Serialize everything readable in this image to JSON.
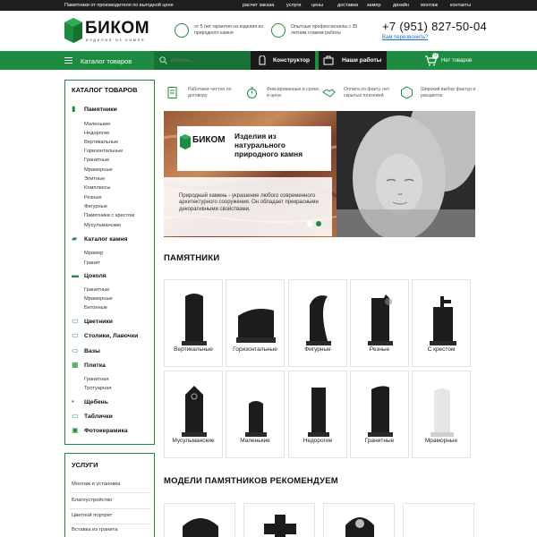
{
  "topbar": {
    "slogan": "Памятники от производителя по выгодной цене",
    "links": [
      "расчет заказа",
      "услуги",
      "цены",
      "доставка",
      "замер",
      "дизайн",
      "монтаж",
      "контакты"
    ]
  },
  "header": {
    "logo_text": "БИКОМ",
    "logo_sub": "изделия из камня",
    "feature1": "от 5 лет гарантия на изделия из природного камня",
    "feature2": "Опытные профессионалы с 35 летним стажем работы",
    "phone": "+7 (951) 827-50-04",
    "callback": "Вам перезвонить?"
  },
  "nav": {
    "catalog": "Каталог товаров",
    "search_placeholder": "Искать...",
    "constructor": "Конструктор",
    "our_works": "Наши работы",
    "cart_count": "0",
    "cart_text": "Нет товаров"
  },
  "sidebar": {
    "title": "КАТАЛОГ ТОВАРОВ",
    "categories": [
      {
        "label": "Памятники",
        "subs": [
          "Маленькие",
          "Недорогие",
          "Вертикальные",
          "Горизонтальные",
          "Гранитные",
          "Мраморные",
          "Элитные",
          "Комплексы",
          "Резные",
          "Фигурные",
          "Памятники с крестом",
          "Мусульманские"
        ]
      },
      {
        "label": "Каталог камня",
        "subs": [
          "Мрамор",
          "Гранит"
        ]
      },
      {
        "label": "Цоколя",
        "subs": [
          "Гранитные",
          "Мраморные",
          "Бетонные"
        ]
      },
      {
        "label": "Цветники",
        "subs": []
      },
      {
        "label": "Столики, Лавочки",
        "subs": []
      },
      {
        "label": "Вазы",
        "subs": []
      },
      {
        "label": "Плитка",
        "subs": [
          "Гранитная",
          "Тротуарная"
        ]
      },
      {
        "label": "Щебень",
        "subs": []
      },
      {
        "label": "Таблички",
        "subs": []
      },
      {
        "label": "Фотокерамика",
        "subs": []
      }
    ]
  },
  "services": {
    "title": "УСЛУГИ",
    "items": [
      "Монтаж и установка",
      "Благоустройство",
      "Цветной портрет",
      "Вставка из гранита"
    ]
  },
  "features": [
    {
      "icon": "document-icon",
      "text": "Работаем честно по договору"
    },
    {
      "icon": "stopwatch-icon",
      "text": "Фиксированные и сроки, и цена"
    },
    {
      "icon": "handshake-icon",
      "text": "Оплата по факту, нет скрытых платежей"
    },
    {
      "icon": "stone-icon",
      "text": "Широкий выбор фактур и расцветок"
    }
  ],
  "banner": {
    "logo": "БИКОМ",
    "title": "Изделия из натурального природного камня",
    "description": "Природный камень - украшение любого современного архитектурного сооружения. Он обладает прекрасными декоративными свойствами."
  },
  "monuments_title": "ПАМЯТНИКИ",
  "monuments": [
    "Вертикальные",
    "Горизонтальные",
    "Фигурные",
    "Резные",
    "С крестом",
    "Мусульманские",
    "Маленькие",
    "Недорогие",
    "Гранитные",
    "Мраморные"
  ],
  "recommend_title": "МОДЕЛИ ПАМЯТНИКОВ РЕКОМЕНДУЕМ",
  "colors": {
    "green": "#1e8c40",
    "dark": "#1a1a1a"
  }
}
